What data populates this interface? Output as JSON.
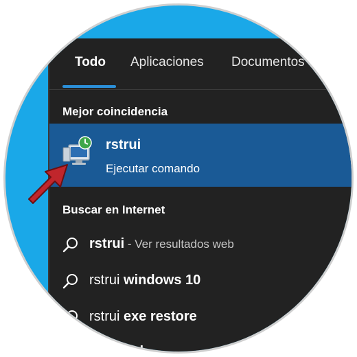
{
  "tabs": [
    {
      "label": "Todo",
      "active": true
    },
    {
      "label": "Aplicaciones",
      "active": false
    },
    {
      "label": "Documentos",
      "active": false
    }
  ],
  "best_match": {
    "heading": "Mejor coincidencia",
    "app_name": "rstrui",
    "app_type": "Ejecutar comando",
    "icon": "system-restore-icon"
  },
  "web": {
    "heading": "Buscar en Internet",
    "results": [
      {
        "query": "rstrui",
        "suggestion": "",
        "hint": " - Ver resultados web"
      },
      {
        "query": "rstrui",
        "suggestion": " windows 10",
        "hint": ""
      },
      {
        "query": "rstrui",
        "suggestion": " exe restore",
        "hint": ""
      }
    ],
    "partial_row": "cmd"
  },
  "colors": {
    "frame_bg": "#1aa8e8",
    "panel_bg": "#222222",
    "selection_bg": "#1a5a96",
    "accent": "#2b8fd8",
    "arrow": "#c0262c"
  }
}
